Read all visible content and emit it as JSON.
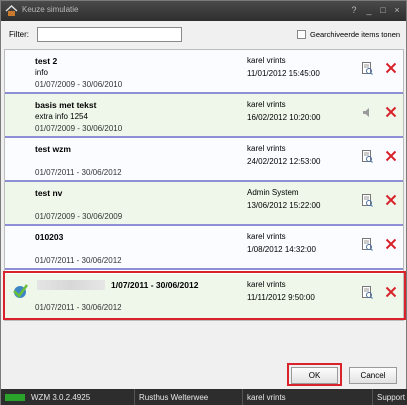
{
  "window": {
    "title": "Keuze simulatie",
    "buttons": {
      "help": "?",
      "minimize": "_",
      "maximize": "□",
      "close": "×"
    }
  },
  "filter": {
    "label": "Filter:",
    "value": "",
    "placeholder": "",
    "archived_label": "Gearchiveerde items tonen",
    "archived_checked": false
  },
  "rows": [
    {
      "name": "test 2",
      "info": "info",
      "period": "01/07/2009 - 30/06/2010",
      "user": "karel vrints",
      "date": "11/01/2012 15:45:00",
      "edit_icon": "document-edit-icon"
    },
    {
      "name": "basis met tekst",
      "info": "extra info 1254",
      "period": "01/07/2009 - 30/06/2010",
      "user": "karel vrints",
      "date": "16/02/2012 10:20:00",
      "edit_icon": "speaker-icon"
    },
    {
      "name": "test wzm",
      "info": "",
      "period": "01/07/2011 - 30/06/2012",
      "user": "karel vrints",
      "date": "24/02/2012 12:53:00",
      "edit_icon": "document-edit-icon"
    },
    {
      "name": "test nv",
      "info": "",
      "period": "01/07/2009 - 30/06/2009",
      "user": "Admin System",
      "date": "13/06/2012 15:22:00",
      "edit_icon": "document-edit-icon"
    },
    {
      "name": "010203",
      "info": "",
      "period": "01/07/2011 - 30/06/2012",
      "user": "karel vrints",
      "date": "1/08/2012 14:32:00",
      "edit_icon": "document-edit-icon"
    },
    {
      "name": "",
      "period_head": "1/07/2011 - 30/06/2012",
      "info": "",
      "period": "01/07/2011 - 30/06/2012",
      "user": "karel vrints",
      "date": "11/11/2012 9:50:00",
      "edit_icon": "document-edit-icon",
      "status_icon": "checkmark-globe-icon"
    }
  ],
  "actions": {
    "ok": "OK",
    "cancel": "Cancel"
  },
  "statusbar": {
    "version": "WZM 3.0.2.4925",
    "school": "Rusthus Welterwee",
    "user": "karel vrints",
    "support": "Support"
  },
  "colors": {
    "highlight": "#d9232c",
    "row_separator": "#8f8fd6",
    "row_alt_bg": "#eef7ea",
    "delete_icon": "#d9232c",
    "status_led": "#29a329"
  }
}
